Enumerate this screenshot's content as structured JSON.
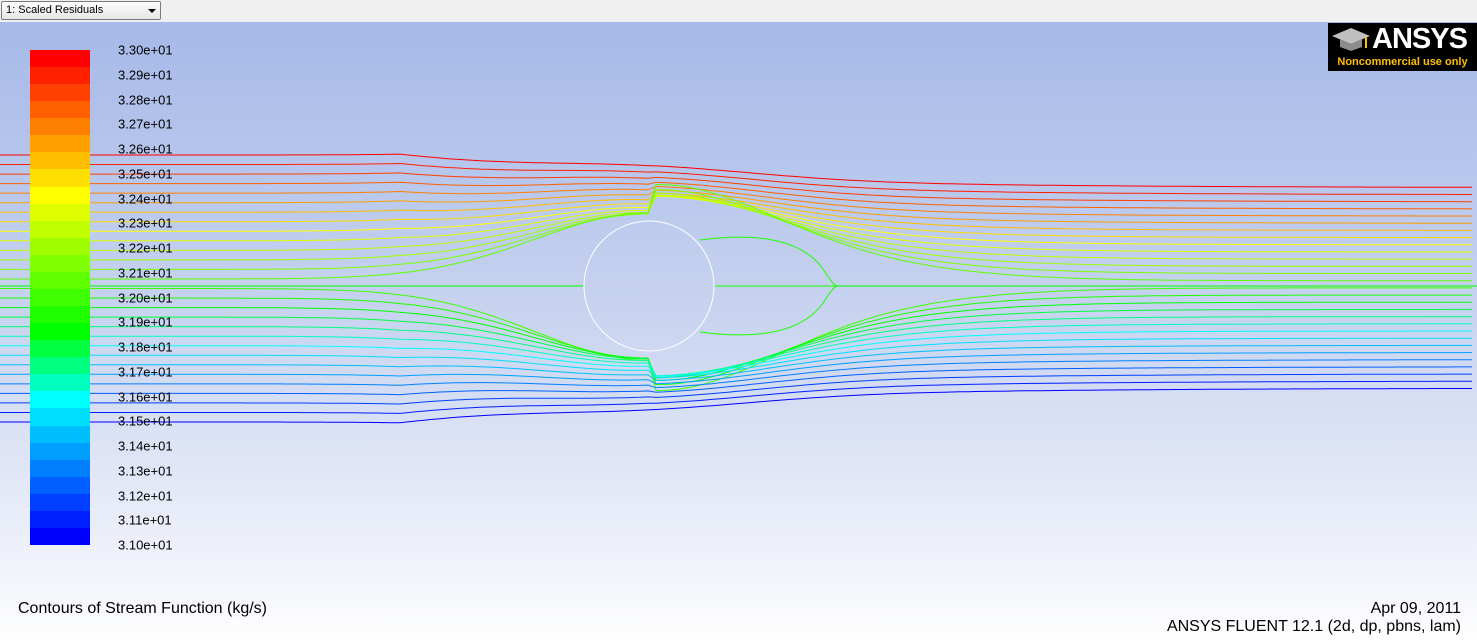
{
  "toolbar": {
    "window_select": "1: Scaled Residuals"
  },
  "logo": {
    "wordmark": "ANSYS",
    "note": "Noncommercial use only"
  },
  "colormap": {
    "labels": [
      "3.30e+01",
      "3.29e+01",
      "3.28e+01",
      "3.27e+01",
      "3.26e+01",
      "3.25e+01",
      "3.24e+01",
      "3.23e+01",
      "3.22e+01",
      "3.21e+01",
      "3.20e+01",
      "3.19e+01",
      "3.18e+01",
      "3.17e+01",
      "3.16e+01",
      "3.15e+01",
      "3.14e+01",
      "3.13e+01",
      "3.12e+01",
      "3.11e+01",
      "3.10e+01"
    ],
    "colors": [
      "#ff0000",
      "#ff2000",
      "#ff4000",
      "#ff6000",
      "#ff7f00",
      "#ff9f00",
      "#ffbf00",
      "#ffdf00",
      "#ffff00",
      "#dfff00",
      "#bfff00",
      "#9fff00",
      "#7fff00",
      "#5fff00",
      "#3fff00",
      "#1fff00",
      "#00ff00",
      "#00ff3f",
      "#00ff7f",
      "#00ffbf",
      "#00ffff",
      "#00dfff",
      "#00bfff",
      "#009fff",
      "#007fff",
      "#005fff",
      "#003fff",
      "#001fff",
      "#0000ff"
    ]
  },
  "footer": {
    "title": "Contours of Stream Function (kg/s)",
    "date": "Apr 09, 2011",
    "version": "ANSYS FLUENT 12.1 (2d, dp, pbns, lam)"
  }
}
